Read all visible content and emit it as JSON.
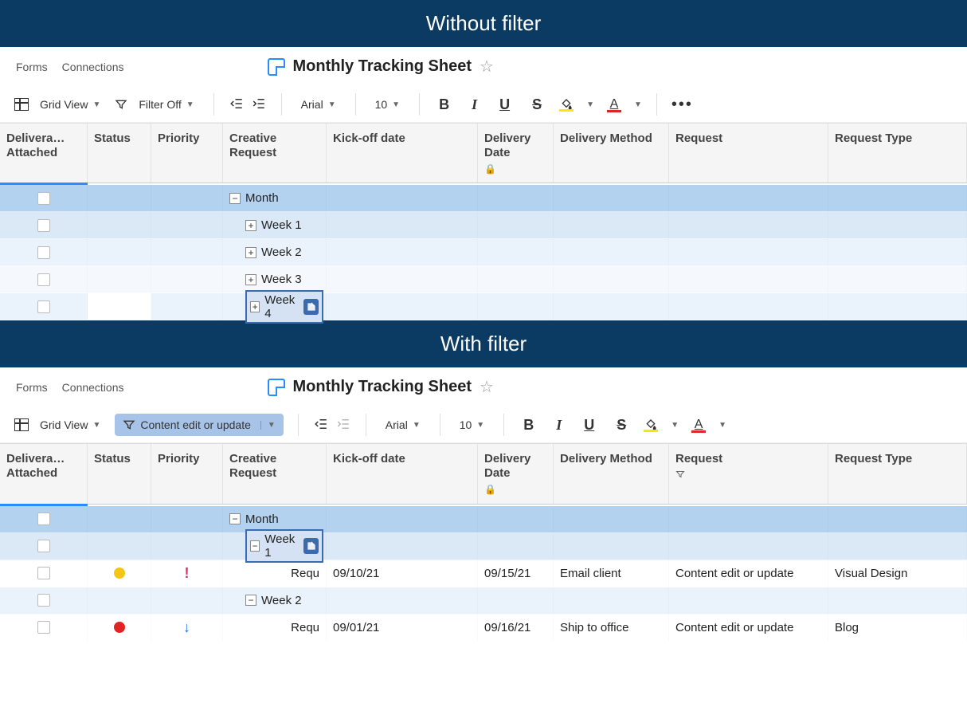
{
  "banners": {
    "without_filter": "Without filter",
    "with_filter": "With filter"
  },
  "nav": {
    "forms": "Forms",
    "connections": "Connections"
  },
  "sheet": {
    "title": "Monthly Tracking Sheet"
  },
  "toolbar": {
    "view_label": "Grid View",
    "filter_off": "Filter Off",
    "filter_active": "Content edit or update",
    "font_family": "Arial",
    "font_size": "10",
    "bold": "B",
    "italic": "I",
    "underline": "U",
    "strike": "S",
    "fill_letter": "A",
    "more": "•••"
  },
  "columns": {
    "deliverable": "Delivera… Attached",
    "status": "Status",
    "priority": "Priority",
    "creative": "Creative Request",
    "kickoff": "Kick-off date",
    "delivery_date": "Delivery Date",
    "delivery_method": "Delivery Method",
    "request": "Request",
    "request_type": "Request Type"
  },
  "rows_no_filter": [
    {
      "type": "month",
      "label": "Month",
      "expand": "−"
    },
    {
      "type": "week",
      "label": "Week 1",
      "expand": "+"
    },
    {
      "type": "week",
      "label": "Week 2",
      "expand": "+"
    },
    {
      "type": "week",
      "label": "Week 3",
      "expand": "+"
    },
    {
      "type": "week_active",
      "label": "Week 4",
      "expand": "+"
    }
  ],
  "rows_with_filter": [
    {
      "type": "month",
      "label": "Month",
      "expand": "−"
    },
    {
      "type": "week_active",
      "label": "Week 1",
      "expand": "−"
    },
    {
      "type": "data",
      "creative": "Requ",
      "status_color": "yellow",
      "priority": "!",
      "kickoff": "09/10/21",
      "delivery_date": "09/15/21",
      "method": "Email client",
      "request": "Content edit or update",
      "request_type": "Visual Design"
    },
    {
      "type": "week",
      "label": "Week 2",
      "expand": "−"
    },
    {
      "type": "data",
      "creative": "Requ",
      "status_color": "red",
      "priority": "↓",
      "kickoff": "09/01/21",
      "delivery_date": "09/16/21",
      "method": "Ship to office",
      "request": "Content edit or update",
      "request_type": "Blog"
    }
  ]
}
